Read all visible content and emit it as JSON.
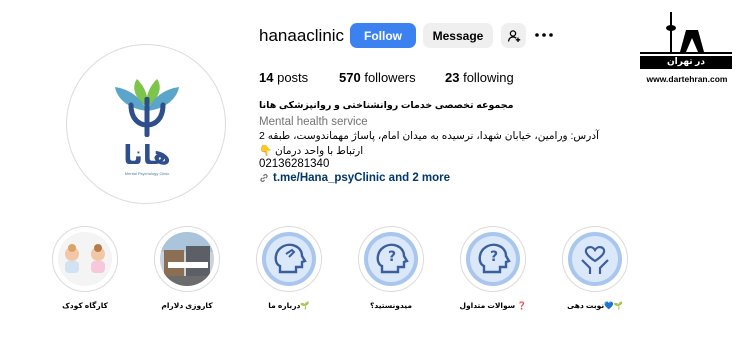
{
  "profile": {
    "username": "hanaaclinic",
    "follow_label": "Follow",
    "message_label": "Message",
    "stats": {
      "posts_count": "14",
      "posts_label": "posts",
      "followers_count": "570",
      "followers_label": "followers",
      "following_count": "23",
      "following_label": "following"
    },
    "bio": {
      "title": "مجموعه تخصصی خدمات روانشناختی و روانپزشکی هانا",
      "subtitle": "Mental health service",
      "address": "آدرس: ورامین، خیابان شهدا، نرسیده به میدان امام، پاساژ مهماندوست، طبقه 2",
      "contact": "ارتباط با واحد درمان 👇",
      "phone": "02136281340",
      "link": "t.me/Hana_psyClinic and 2 more"
    },
    "avatar": {
      "logo_text": "هانا",
      "fine_print": "Mental Psychology Clinic"
    }
  },
  "highlights": [
    {
      "label": "کارگاه کودک",
      "icon": "baby-photos"
    },
    {
      "label": "کاروزی دلارام",
      "icon": "building-photo"
    },
    {
      "label": "درباره ما🌱",
      "icon": "head-hand-icon"
    },
    {
      "label": "میدونستید؟",
      "icon": "head-question-icon"
    },
    {
      "label": "سوالات متداول ❓",
      "icon": "head-question-icon"
    },
    {
      "label": "نوبت دهی💙🌱",
      "icon": "hands-heart-icon"
    }
  ],
  "watermark": {
    "brand_text": "در تهران",
    "url": "www.dartehran.com"
  },
  "colors": {
    "follow_button": "#3b82f0",
    "link": "#00376b",
    "highlight_blue": "#a9c6ef",
    "logo_blue": "#2f4e8c",
    "logo_green": "#7cc44a"
  }
}
